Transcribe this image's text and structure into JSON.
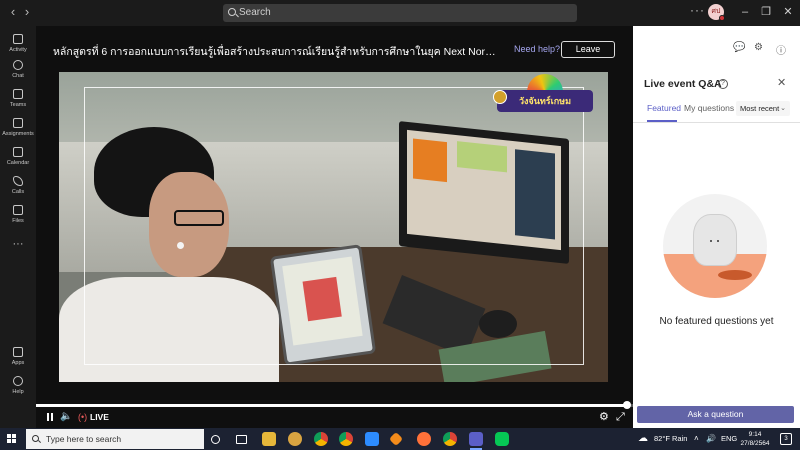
{
  "titlebar": {
    "search_placeholder": "Search",
    "more_label": "···",
    "avatar_initials": "ศป"
  },
  "rail": [
    {
      "label": "Activity",
      "icon": "bell-icon"
    },
    {
      "label": "Chat",
      "icon": "chat-icon"
    },
    {
      "label": "Teams",
      "icon": "teams-icon"
    },
    {
      "label": "Assignments",
      "icon": "assignments-icon"
    },
    {
      "label": "Calendar",
      "icon": "calendar-icon"
    },
    {
      "label": "Calls",
      "icon": "phone-icon"
    },
    {
      "label": "Files",
      "icon": "file-icon"
    },
    {
      "label": "Apps",
      "icon": "apps-icon"
    },
    {
      "label": "Help",
      "icon": "help-icon"
    }
  ],
  "event": {
    "title": "หลักสูตรที่ 6 การออกแบบการเรียนรู้เพื่อสร้างประสบการณ์เรียนรู้สำหรับการศึกษาในยุค Next Normal Education Rei...",
    "need_help": "Need help?",
    "leave": "Leave",
    "live_label": "LIVE",
    "progress": 1.0,
    "logo_text": "วังจันทร์เกษม"
  },
  "qa": {
    "title": "Live event Q&A",
    "tabs": [
      "Featured",
      "My questions"
    ],
    "active_tab": "Featured",
    "sort": "Most recent",
    "empty_text": "No featured questions yet",
    "ask_button": "Ask a question"
  },
  "taskbar": {
    "search_placeholder": "Type here to search",
    "weather": "82°F  Rain",
    "language": "ENG",
    "time": "9:14",
    "date": "27/8/2564",
    "notifications": "3"
  },
  "colors": {
    "accent": "#6264a7",
    "accent_text": "#5b5fc7",
    "live_red": "#e85a5a"
  }
}
